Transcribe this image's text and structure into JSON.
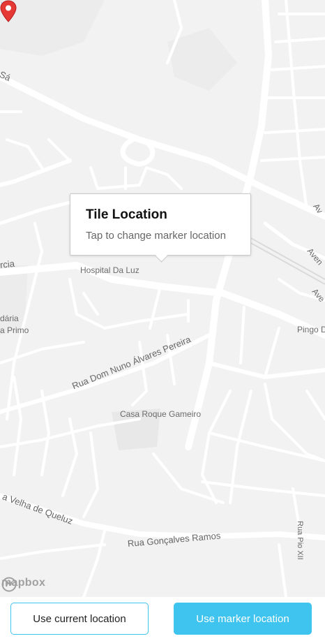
{
  "map": {
    "labels": {
      "hospital": "Hospital Da Luz",
      "street_alvares": "Rua Dom Nuno Álvares Pereira",
      "casa": "Casa Roque Gameiro",
      "street_queluz": "a Velha de Queluz",
      "street_goncalves": "Rua Gonçalves Ramos",
      "pingo": "Pingo D",
      "rua_pio": "Rua Pio XII",
      "arcia": "rcia",
      "daria": "dária",
      "aprimo": "a Primo",
      "sa": "Sá",
      "av1": "Av",
      "av2": "Aven",
      "av3": "Ave"
    },
    "colors": {
      "land": "#f2f2f2",
      "road": "#ffffff",
      "park": "#e9e9e9",
      "pin": "#e53935",
      "user_dot": "#4a90e2"
    }
  },
  "callout": {
    "title": "Tile Location",
    "subtitle": "Tap to change marker location"
  },
  "attribution": {
    "text": "mapbox"
  },
  "buttons": {
    "current_location": "Use current location",
    "marker_location": "Use marker location",
    "accent": "#3fc3ef"
  }
}
